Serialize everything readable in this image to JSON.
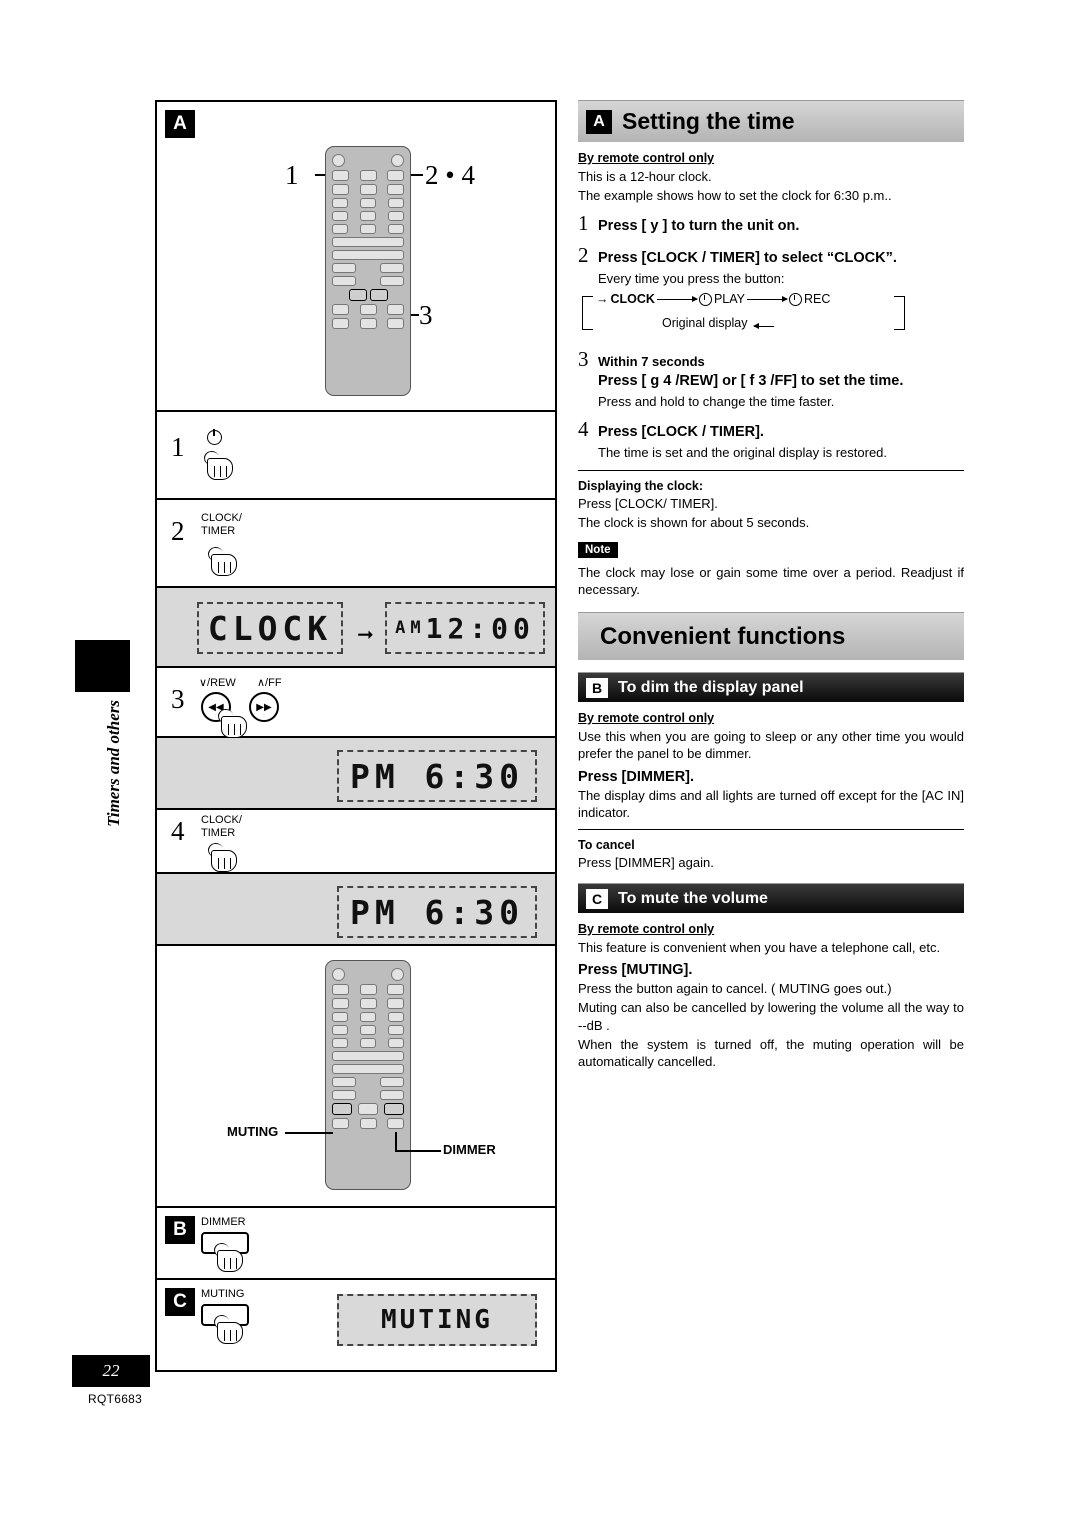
{
  "page": {
    "number": "22",
    "code": "RQT6683",
    "side_label": "Timers and others"
  },
  "left": {
    "panel_a_letter": "A",
    "callouts": {
      "c1": "1",
      "c2": "2 • 4",
      "c3": "3"
    },
    "steps": [
      {
        "num": "1",
        "label": "",
        "icon": "power-icon"
      },
      {
        "num": "2",
        "label": "CLOCK/\nTIMER",
        "icon": "clock-timer-button"
      },
      {
        "num": "3",
        "label_left": "/REW",
        "label_right": "/FF",
        "icon": "rew-ff-buttons"
      },
      {
        "num": "4",
        "label": "CLOCK/\nTIMER",
        "icon": "clock-timer-button"
      }
    ],
    "display_clock": "CLOCK",
    "display_am1200_prefix": "AM",
    "display_am1200": "12:00",
    "display_pm630": "PM  6:30",
    "display_pm630b": "PM  6:30",
    "display_muting": "MUTING",
    "remote_labels": {
      "muting": "MUTING",
      "dimmer": "DIMMER"
    },
    "panel_b": {
      "letter": "B",
      "label": "DIMMER"
    },
    "panel_c": {
      "letter": "C",
      "label": "MUTING"
    }
  },
  "right": {
    "section_a": {
      "badge": "A",
      "title": "Setting the time",
      "by_remote": "By remote control only",
      "line1": "This is a 12-hour clock.",
      "line2": "The example shows how to set the clock for 6:30 p.m..",
      "step1_num": "1",
      "step1_text": "Press [ y ] to turn the unit on.",
      "step2_num": "2",
      "step2_text": "Press [CLOCK / TIMER] to select “CLOCK”.",
      "step2_sub": "Every time you press the button:",
      "flow_clock": "CLOCK",
      "flow_play": "PLAY",
      "flow_rec": "REC",
      "flow_original": "Original display",
      "step3_num": "3",
      "step3_head": "Within 7 seconds",
      "step3_text": "Press [ g      4 /REW] or [ f      3 /FF] to set the time.",
      "step3_sub": "Press and hold to change the time faster.",
      "step4_num": "4",
      "step4_text": "Press [CLOCK / TIMER].",
      "step4_sub": "The time is set and the original display is restored.",
      "display_head": "Displaying the clock:",
      "display_line1": "Press [CLOCK/ TIMER].",
      "display_line2": "The clock is shown for about 5 seconds.",
      "note_badge": "Note",
      "note_text": "The clock may lose or gain some time over a period. Readjust if necessary."
    },
    "section_convenient": {
      "title": "Convenient functions"
    },
    "section_b": {
      "badge": "B",
      "title": "To dim the display panel",
      "by_remote": "By remote control only",
      "intro": "Use this when you are going to sleep or any other time you would prefer the panel to be dimmer.",
      "press": "Press [DIMMER].",
      "body": "The display dims and all lights are turned off except for the [AC IN] indicator.",
      "cancel_head": "To cancel",
      "cancel_text": "Press [DIMMER] again."
    },
    "section_c": {
      "badge": "C",
      "title": "To mute the volume",
      "by_remote": "By remote control only",
      "intro": "This feature is convenient when you have a telephone call, etc.",
      "press": "Press [MUTING].",
      "body1": "Press the button again to cancel. ( MUTING  goes out.)",
      "body2": "Muting can also be cancelled by lowering the volume all the way to  --dB .",
      "body3": "When the system is turned off, the muting operation will be automatically cancelled."
    }
  }
}
